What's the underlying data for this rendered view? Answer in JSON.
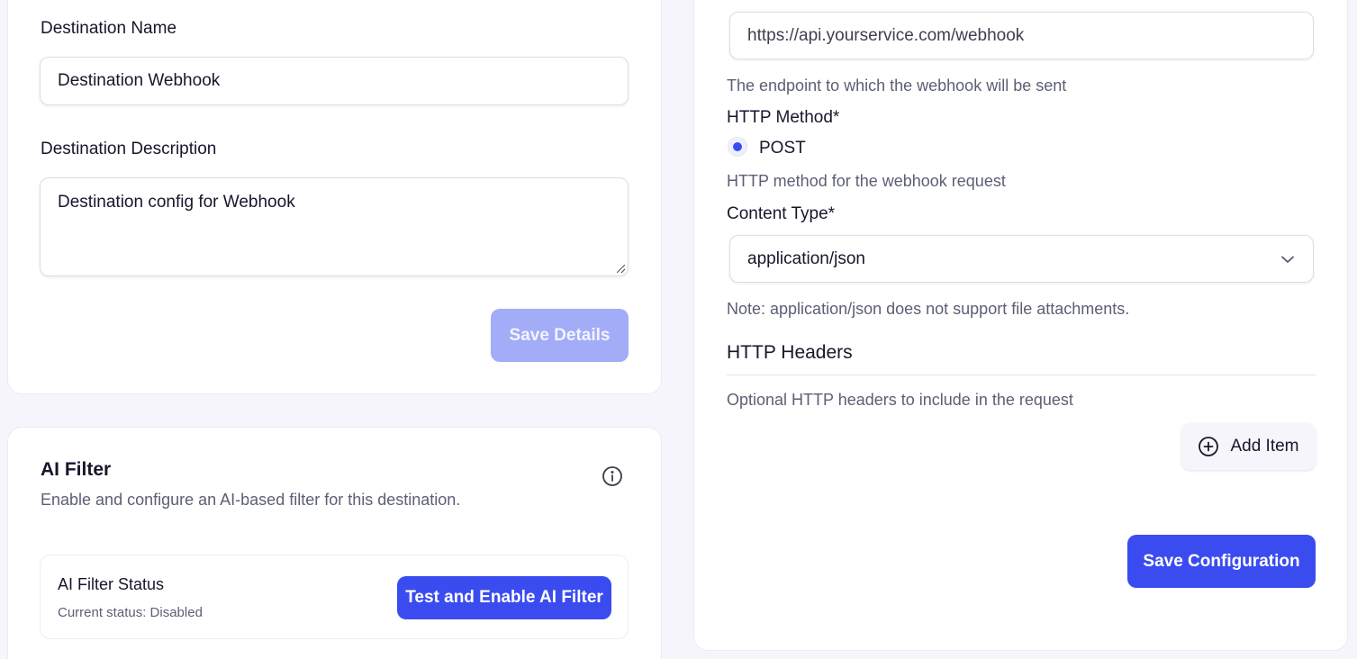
{
  "details": {
    "name_label": "Destination Name",
    "name_value": "Destination Webhook",
    "description_label": "Destination Description",
    "description_value": "Destination config for Webhook",
    "save_label": "Save Details"
  },
  "ai_filter": {
    "title": "AI Filter",
    "subtitle": "Enable and configure an AI-based filter for this destination.",
    "status_title": "AI Filter Status",
    "status_text": "Current status: Disabled",
    "enable_button": "Test and Enable AI Filter",
    "info_icon": "info-icon"
  },
  "config": {
    "url_value": "https://api.yourservice.com/webhook",
    "url_help": "The endpoint to which the webhook will be sent",
    "method_label": "HTTP Method*",
    "method_option": "POST",
    "method_help": "HTTP method for the webhook request",
    "content_type_label": "Content Type*",
    "content_type_value": "application/json",
    "content_type_note": "Note: application/json does not support file attachments.",
    "headers_title": "HTTP Headers",
    "headers_help": "Optional HTTP headers to include in the request",
    "add_item_label": "Add Item",
    "save_label": "Save Configuration"
  },
  "colors": {
    "primary": "#3a4cf0",
    "primary_disabled": "#a3acf7",
    "background": "#f6f5fc"
  }
}
